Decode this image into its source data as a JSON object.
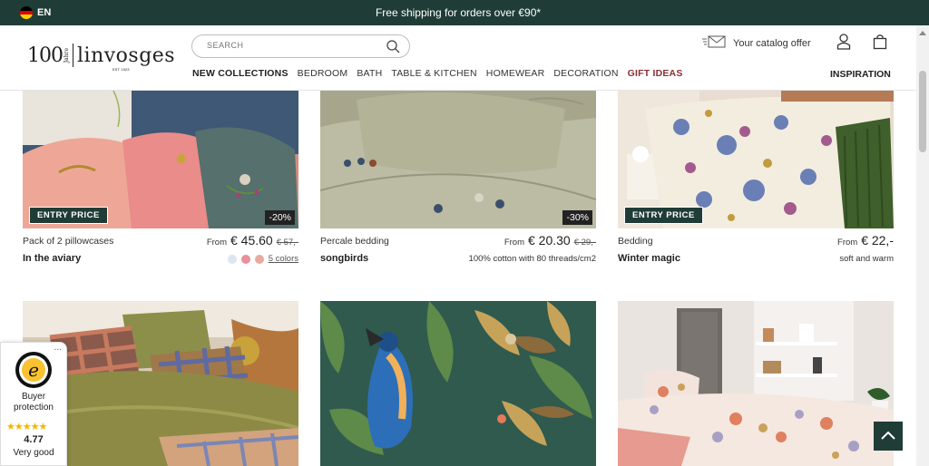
{
  "topbar": {
    "lang": "EN",
    "promo": "Free shipping for orders over €90*"
  },
  "logo": {
    "number": "100",
    "jahre": "Jahre",
    "name": "linvosges",
    "est": "EST. 1923"
  },
  "search": {
    "placeholder": "SEARCH"
  },
  "nav": [
    "NEW COLLECTIONS",
    "BEDROOM",
    "BATH",
    "TABLE & KITCHEN",
    "HOMEWEAR",
    "DECORATION",
    "GIFT IDEAS"
  ],
  "header": {
    "catalog": "Your catalog offer",
    "inspiration": "INSPIRATION"
  },
  "products": [
    {
      "category": "Pack of 2 pillowcases",
      "from": "From",
      "price": "€ 45.60",
      "old_price": "€ 57,-",
      "name": "In the aviary",
      "badge": "ENTRY PRICE",
      "discount": "-20%",
      "colors_link": "5 colors",
      "swatches": [
        "#dde6ef",
        "#e9909a",
        "#e8a9a0"
      ]
    },
    {
      "category": "Percale bedding",
      "from": "From",
      "price": "€ 20.30",
      "old_price": "€ 29,-",
      "name": "songbirds",
      "discount": "-30%",
      "detail": "100% cotton with 80 threads/cm2"
    },
    {
      "category": "Bedding",
      "from": "From",
      "price": "€ 22,-",
      "name": "Winter magic",
      "badge": "ENTRY PRICE",
      "detail": "soft and warm"
    }
  ],
  "trust": {
    "more": "...",
    "label": "Buyer protection",
    "stars": "★★★★★",
    "rating": "4.77",
    "rating_text": "Very good"
  },
  "colors": {
    "brand": "#1f3d36",
    "gift": "#8a2e35",
    "star": "#f2b600"
  }
}
